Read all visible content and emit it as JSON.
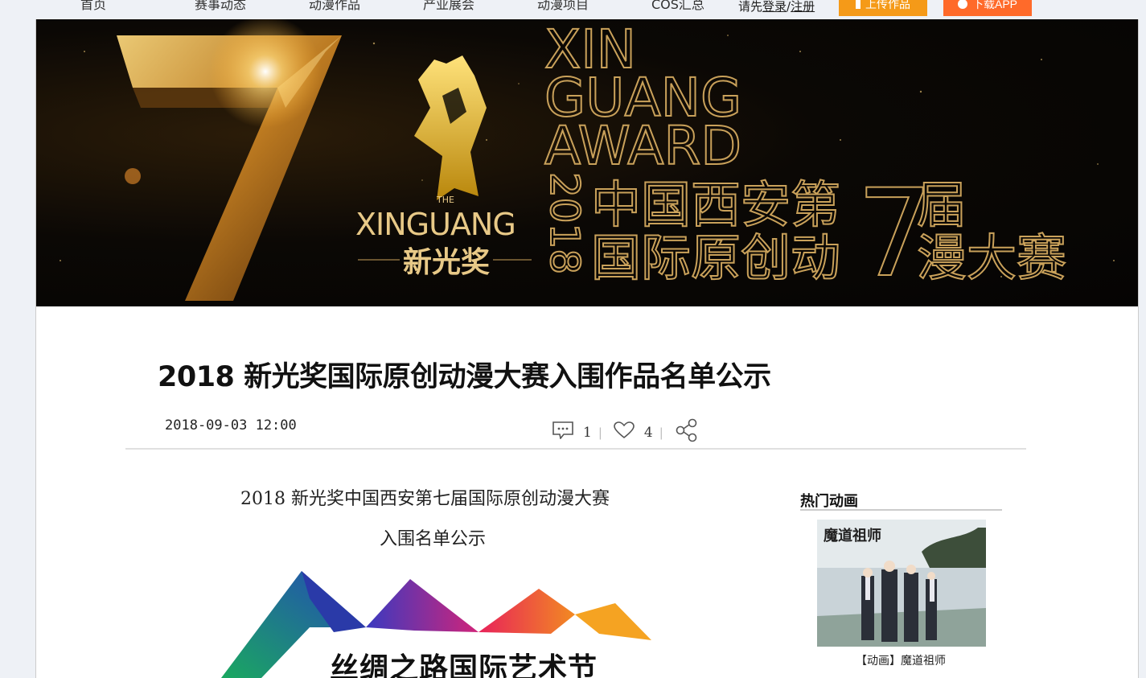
{
  "nav": {
    "items": [
      "首页",
      "赛事动态",
      "动漫作品",
      "产业展会",
      "动漫项目",
      "COS汇总"
    ],
    "login_prefix": "请先",
    "login_link": "登录",
    "register_link": "注册",
    "upload_label": "上传作品",
    "app_label": "下载APP"
  },
  "banner": {
    "en_line1": "XIN",
    "en_line2": "GUANG",
    "en_line3": "AWARD",
    "year": "2018",
    "cn_line1": "中国西安第",
    "cn_line2": "国际原创动",
    "edition": "7",
    "cn_right1": "届",
    "cn_right2": "漫大赛",
    "logo_the": "THE",
    "logo_en": "XINGUANG",
    "logo_cn": "新光奖",
    "big_number": "7"
  },
  "article": {
    "title": "2018 新光奖国际原创动漫大赛入围作品名单公示",
    "date": "2018-09-03 12:00",
    "comments": "1",
    "likes": "4",
    "body_line1": "2018  新光奖中国西安第七届国际原创动漫大赛",
    "body_line2": "入围名单公示",
    "festival_text": "丝绸之路国际艺术节"
  },
  "sidebar": {
    "title": "热门动画",
    "caption": "【动画】魔道祖师",
    "thumb_title": "魔道祖师"
  },
  "colors": {
    "gold": "#c9a15a",
    "upload_orange": "#f59a18",
    "app_orange": "#ff6a2a"
  }
}
